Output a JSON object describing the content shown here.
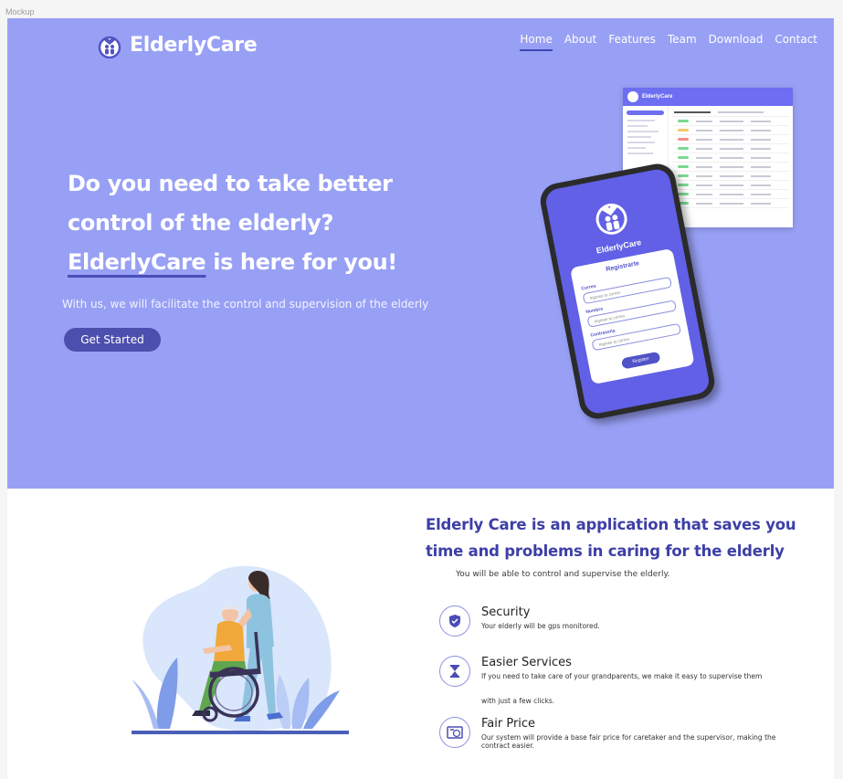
{
  "canvas_label": "Mockup",
  "brand": {
    "name": "ElderlyCare",
    "accent": "#98a0f5",
    "primary": "#3d3fa6"
  },
  "nav": {
    "items": [
      "Home",
      "About",
      "Features",
      "Team",
      "Download",
      "Contact"
    ],
    "active": "Home"
  },
  "hero": {
    "title_line1": "Do you need to take better",
    "title_line2": "control of the elderly?",
    "title_brand": "ElderlyCare",
    "title_tail": " is here for you!",
    "subtitle": "With us, we will facilitate the control and supervision of the elderly",
    "cta_label": "Get Started"
  },
  "dashboard_mockup": {
    "title": "ElderlyCare"
  },
  "phone_mockup": {
    "brand": "ElderlyCare",
    "form_title": "Registrarte",
    "fields": [
      {
        "label": "Correo",
        "placeholder": "Ingrese tu correo"
      },
      {
        "label": "Nombre",
        "placeholder": "Ingrese tu correo"
      },
      {
        "label": "Contraseña",
        "placeholder": "Ingrese tu correo"
      }
    ],
    "submit_label": "Register"
  },
  "info": {
    "title": "Elderly Care is an application that saves you time and problems in caring for the elderly",
    "subtitle": "You will be able to control and supervise the elderly.",
    "features": [
      {
        "icon": "shield-icon",
        "name": "Security",
        "description": "Your elderly will be gps monitored."
      },
      {
        "icon": "hourglass-icon",
        "name": "Easier Services",
        "description": "If you need to take care of your grandparents, we make it easy to supervise them",
        "description2": "with just a few clicks."
      },
      {
        "icon": "price-tag-icon",
        "name": "Fair Price",
        "description": "Our system will provide a base fair price for caretaker and the supervisor, making the contract easier."
      }
    ]
  }
}
